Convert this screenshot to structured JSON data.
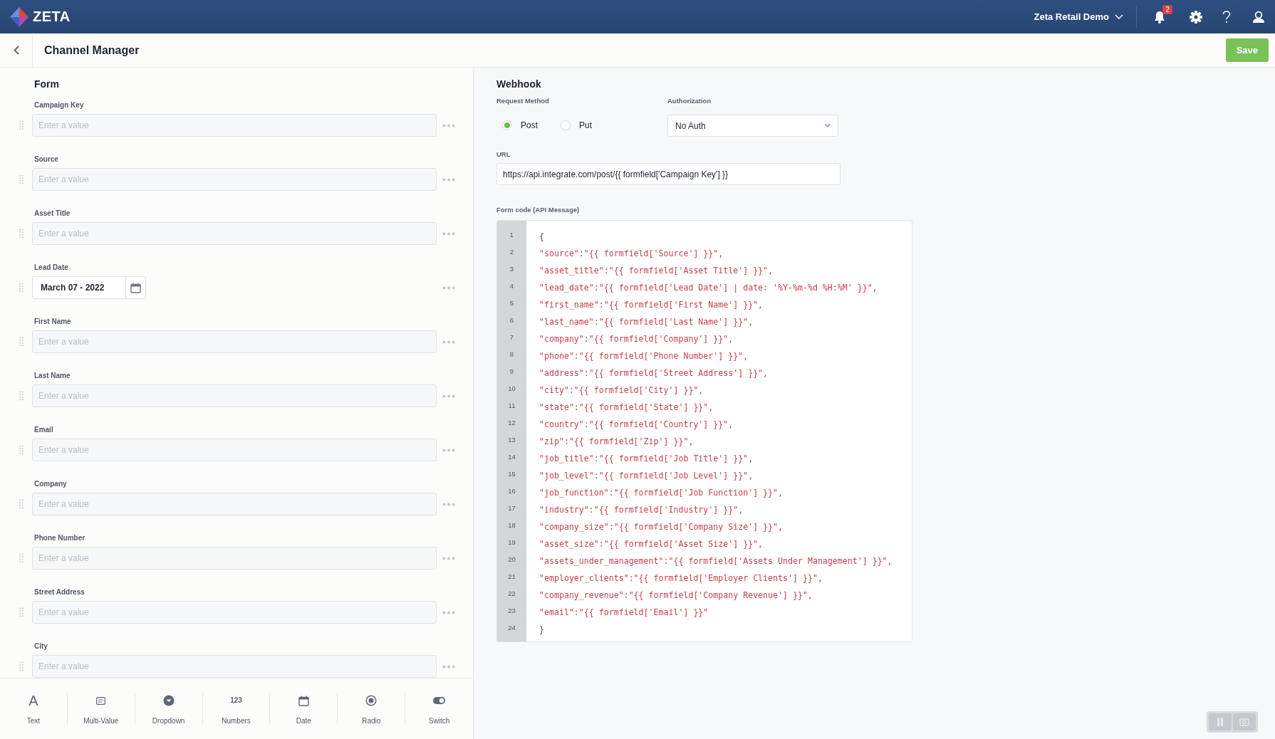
{
  "header": {
    "brand": "ZETA",
    "account": "Zeta Retail Demo",
    "notifications": "2"
  },
  "page": {
    "title": "Channel Manager",
    "save": "Save"
  },
  "form": {
    "title": "Form",
    "fields": [
      {
        "label": "Campaign Key",
        "kind": "text",
        "placeholder": "Enter a value"
      },
      {
        "label": "Source",
        "kind": "text",
        "placeholder": "Enter a value"
      },
      {
        "label": "Asset Title",
        "kind": "text",
        "placeholder": "Enter a value"
      },
      {
        "label": "Lead Date",
        "kind": "date",
        "value": "March 07 - 2022"
      },
      {
        "label": "First Name",
        "kind": "text",
        "placeholder": "Enter a value"
      },
      {
        "label": "Last Name",
        "kind": "text",
        "placeholder": "Enter a value"
      },
      {
        "label": "Email",
        "kind": "text",
        "placeholder": "Enter a value"
      },
      {
        "label": "Company",
        "kind": "text",
        "placeholder": "Enter a value"
      },
      {
        "label": "Phone Number",
        "kind": "text",
        "placeholder": "Enter a value"
      },
      {
        "label": "Street Address",
        "kind": "text",
        "placeholder": "Enter a value"
      },
      {
        "label": "City",
        "kind": "text",
        "placeholder": "Enter a value"
      }
    ]
  },
  "palette": [
    {
      "kind": "text",
      "glyph": "A",
      "label": "Text"
    },
    {
      "kind": "multi",
      "label": "Multi-Value"
    },
    {
      "kind": "dropdown",
      "label": "Dropdown"
    },
    {
      "kind": "numbers",
      "glyph": "123",
      "label": "Numbers"
    },
    {
      "kind": "date",
      "label": "Date"
    },
    {
      "kind": "radio",
      "label": "Radio"
    },
    {
      "kind": "switch",
      "label": "Switch"
    }
  ],
  "webhook": {
    "title": "Webhook",
    "method_label": "Request Method",
    "methods": [
      {
        "label": "Post",
        "selected": true
      },
      {
        "label": "Put",
        "selected": false
      }
    ],
    "auth_label": "Authorization",
    "auth_value": "No Auth",
    "url_label": "URL",
    "url": "https://api.integrate.com/post/{{ formfield['Campaign Key'] }}",
    "code_label": "Form code (API Message)",
    "code": [
      {
        "number": "1",
        "kind": "brace",
        "text": "{"
      },
      {
        "number": "2",
        "kind": "entry",
        "text": "\"source\":\"{{ formfield['Source'] }}\","
      },
      {
        "number": "3",
        "kind": "entry",
        "text": "\"asset_title\":\"{{ formfield['Asset Title'] }}\","
      },
      {
        "number": "4",
        "kind": "entry",
        "text": "\"lead_date\":\"{{ formfield['Lead Date'] | date: '%Y-%m-%d %H:%M' }}\","
      },
      {
        "number": "5",
        "kind": "entry",
        "text": "\"first_name\":\"{{ formfield['First Name'] }}\","
      },
      {
        "number": "6",
        "kind": "entry",
        "text": "\"last_name\":\"{{ formfield['Last Name'] }}\","
      },
      {
        "number": "7",
        "kind": "entry",
        "text": "\"company\":\"{{ formfield['Company'] }}\","
      },
      {
        "number": "8",
        "kind": "entry",
        "text": "\"phone\":\"{{ formfield['Phone Number'] }}\","
      },
      {
        "number": "9",
        "kind": "entry",
        "text": "\"address\":\"{{ formfield['Street Address'] }}\","
      },
      {
        "number": "10",
        "kind": "entry",
        "text": "\"city\":\"{{ formfield['City'] }}\","
      },
      {
        "number": "11",
        "kind": "entry",
        "text": "\"state\":\"{{ formfield['State'] }}\","
      },
      {
        "number": "12",
        "kind": "entry",
        "text": "\"country\":\"{{ formfield['Country'] }}\","
      },
      {
        "number": "13",
        "kind": "entry",
        "text": "\"zip\":\"{{ formfield['Zip'] }}\","
      },
      {
        "number": "14",
        "kind": "entry",
        "text": "\"job_title\":\"{{ formfield['Job Title'] }}\","
      },
      {
        "number": "15",
        "kind": "entry",
        "text": "\"job_level\":\"{{ formfield['Job Level'] }}\","
      },
      {
        "number": "16",
        "kind": "entry",
        "text": "\"job_function\":\"{{ formfield['Job Function'] }}\","
      },
      {
        "number": "17",
        "kind": "entry",
        "text": "\"industry\":\"{{ formfield['Industry'] }}\","
      },
      {
        "number": "18",
        "kind": "entry",
        "text": "\"company_size\":\"{{ formfield['Company Size'] }}\","
      },
      {
        "number": "19",
        "kind": "entry",
        "text": "\"asset_size\":\"{{ formfield['Asset Size'] }}\","
      },
      {
        "number": "20",
        "kind": "entry",
        "text": "\"assets_under_management\":\"{{ formfield['Assets Under Management'] }}\","
      },
      {
        "number": "21",
        "kind": "entry",
        "text": "\"employer_clients\":\"{{ formfield['Employer Clients'] }}\","
      },
      {
        "number": "22",
        "kind": "entry",
        "text": "\"company_revenue\":\"{{ formfield['Company Revenue'] }}\","
      },
      {
        "number": "23",
        "kind": "entry",
        "text": "\"email\":\"{{ formfield['Email'] }}\""
      },
      {
        "number": "24",
        "kind": "brace",
        "text": "}"
      }
    ]
  }
}
